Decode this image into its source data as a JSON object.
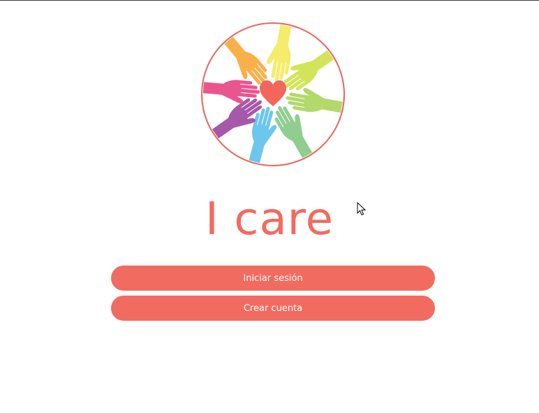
{
  "app": {
    "title": "I care"
  },
  "logo": {
    "icon": "hands-circle-heart-icon",
    "ring_color": "#e8675e",
    "heart_color": "#f2665c",
    "hand_colors": [
      "#f7b04a",
      "#f4ec6a",
      "#d3e45a",
      "#b2d96a",
      "#8fce8f",
      "#6cc6ee",
      "#a659a8",
      "#e9558f"
    ]
  },
  "buttons": {
    "login_label": "Iniciar sesión",
    "signup_label": "Crear cuenta"
  },
  "colors": {
    "accent": "#f26b60",
    "button_text": "#ffffff",
    "background": "#ffffff"
  }
}
